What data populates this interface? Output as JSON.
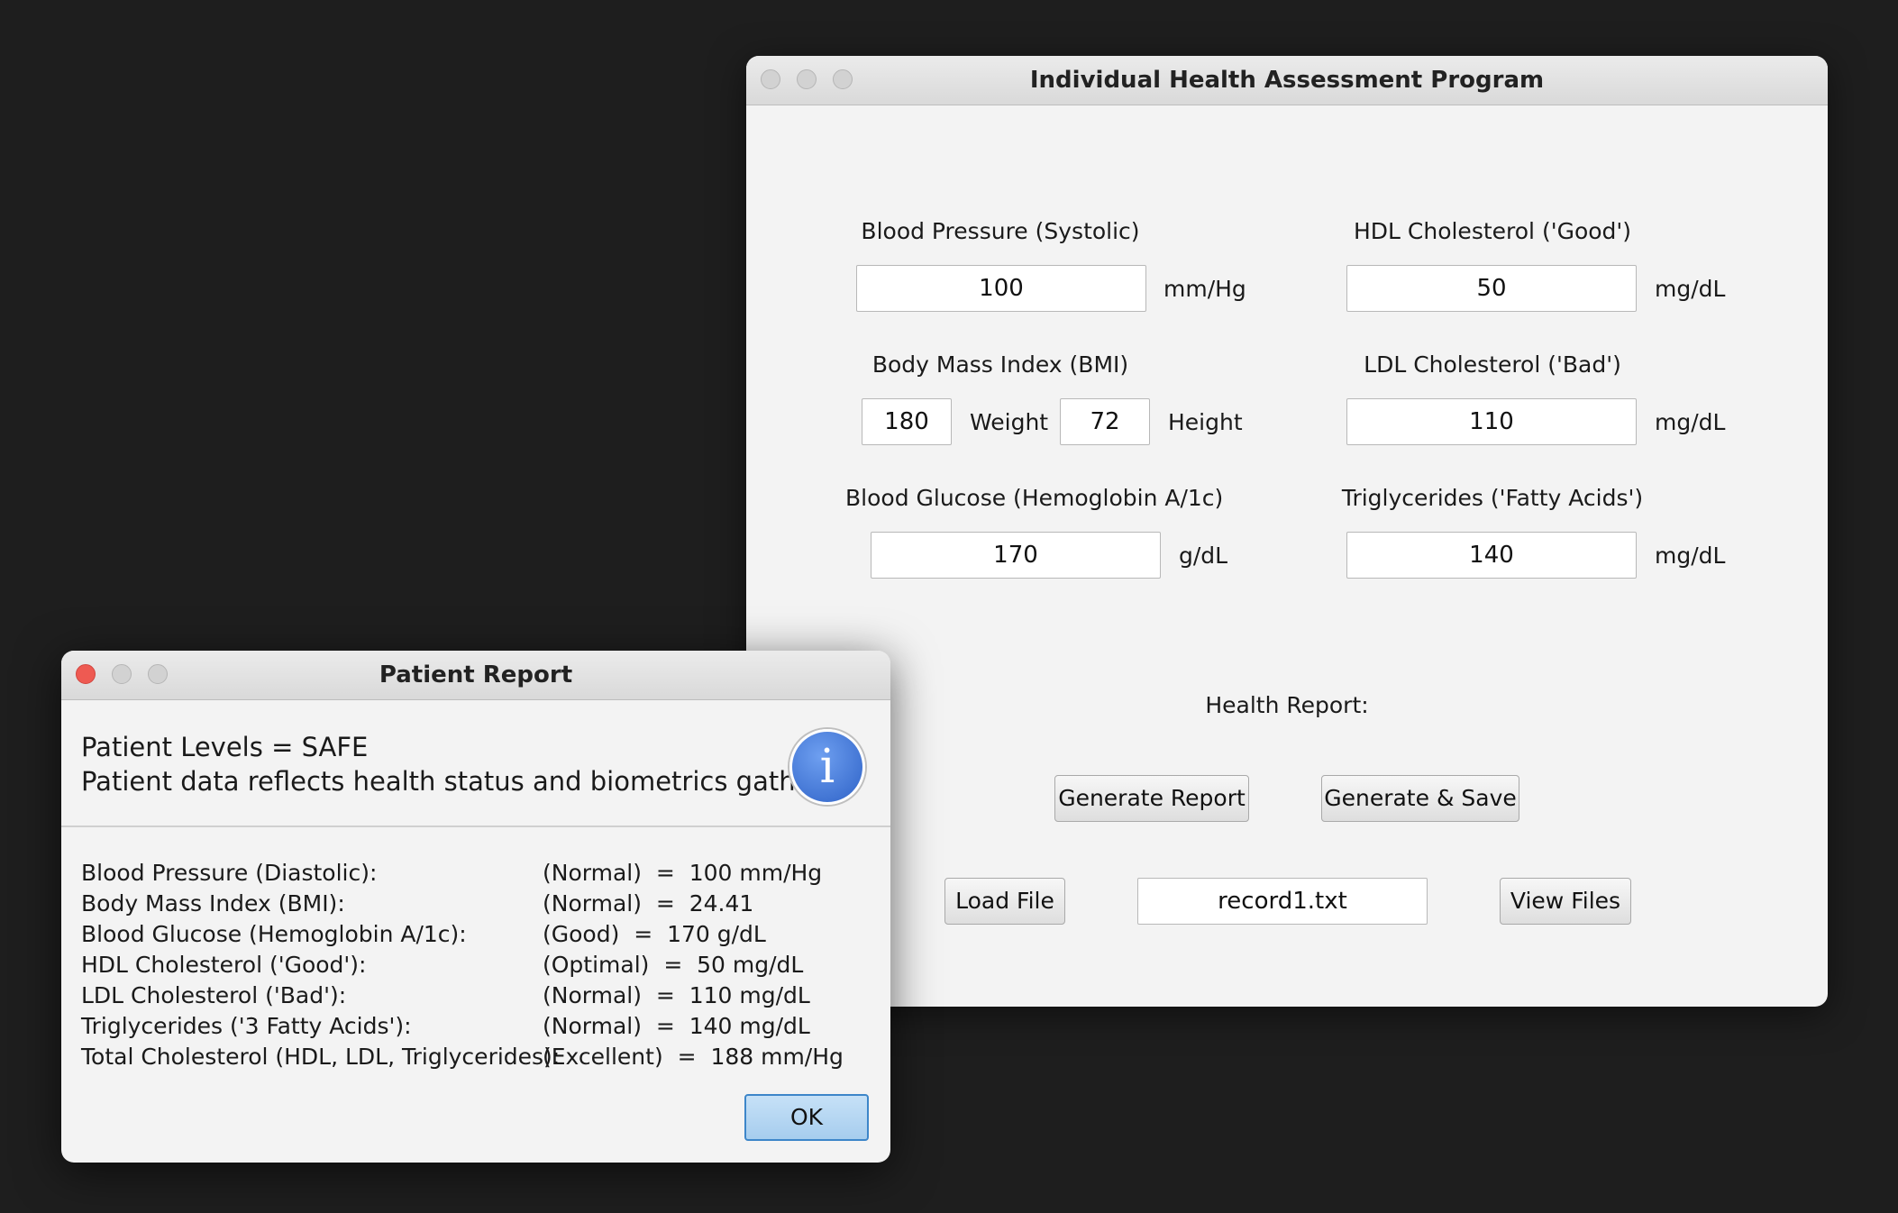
{
  "main_window": {
    "title": "Individual Health Assessment Program",
    "bp_label": "Blood Pressure (Systolic)",
    "bp_value": "100",
    "bp_unit": "mm/Hg",
    "hdl_label": "HDL Cholesterol ('Good')",
    "hdl_value": "50",
    "hdl_unit": "mg/dL",
    "bmi_label": "Body Mass Index (BMI)",
    "weight_value": "180",
    "weight_label": "Weight",
    "height_value": "72",
    "height_label": "Height",
    "ldl_label": "LDL Cholesterol ('Bad')",
    "ldl_value": "110",
    "ldl_unit": "mg/dL",
    "glucose_label": "Blood Glucose (Hemoglobin A/1c)",
    "glucose_value": "170",
    "glucose_unit": "g/dL",
    "trig_label": "Triglycerides ('Fatty Acids')",
    "trig_value": "140",
    "trig_unit": "mg/dL",
    "health_report_label": "Health Report:",
    "generate_report_btn": "Generate Report",
    "generate_save_btn": "Generate & Save",
    "load_file_btn": "Load File",
    "file_value": "record1.txt",
    "view_files_btn": "View Files"
  },
  "report_dialog": {
    "title": "Patient Report",
    "header_line1": "Patient Levels = SAFE",
    "header_line2": "Patient data reflects health status and biometrics gathered",
    "info_icon_glyph": "i",
    "rows": [
      {
        "label": "Blood Pressure (Diastolic):",
        "value": "(Normal)  =  100 mm/Hg"
      },
      {
        "label": "Body Mass Index (BMI):",
        "value": "(Normal)  =  24.41"
      },
      {
        "label": "Blood Glucose (Hemoglobin A/1c):",
        "value": "(Good)  =  170 g/dL"
      },
      {
        "label": "HDL Cholesterol ('Good'):",
        "value": "(Optimal)  =  50 mg/dL"
      },
      {
        "label": "LDL Cholesterol ('Bad'):",
        "value": "(Normal)  =  110 mg/dL"
      },
      {
        "label": "Triglycerides ('3 Fatty Acids'):",
        "value": "(Normal)  =  140 mg/dL"
      },
      {
        "label": "Total Cholesterol (HDL, LDL, Triglycerides):",
        "value": "(Excellent)  =  188 mm/Hg"
      }
    ],
    "ok_btn": "OK"
  },
  "colors": {
    "desktop": "#1e1e1e",
    "window_bg": "#f3f3f3",
    "close_red": "#ee5a52",
    "info_blue": "#2e62c7",
    "ok_blue": "#a6cdee"
  }
}
